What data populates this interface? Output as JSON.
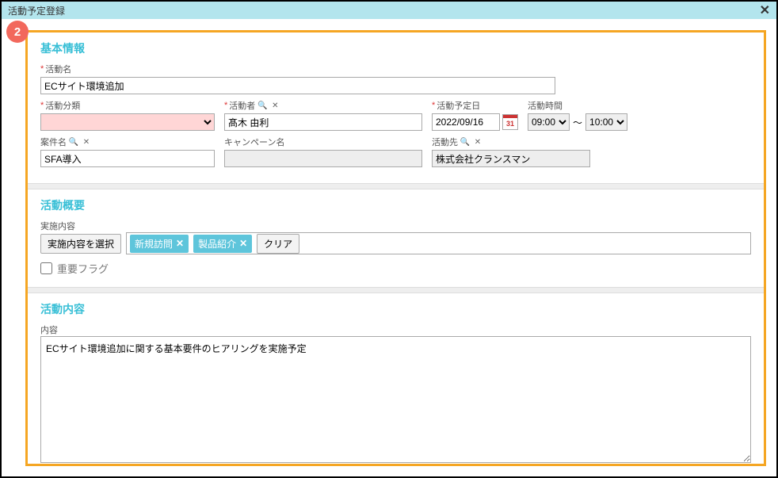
{
  "window": {
    "title": "活動予定登録"
  },
  "badge": "2",
  "section_basic": {
    "title": "基本情報",
    "activity_name": {
      "label": "活動名",
      "value": "ECサイト環境追加"
    },
    "activity_category": {
      "label": "活動分類"
    },
    "activity_person": {
      "label": "活動者",
      "value": "髙木 由利"
    },
    "scheduled_date": {
      "label": "活動予定日",
      "value": "2022/09/16",
      "cal_day": "31"
    },
    "activity_time": {
      "label": "活動時間",
      "from": "09:00",
      "to": "10:00"
    },
    "case_name": {
      "label": "案件名",
      "value": "SFA導入"
    },
    "campaign_name": {
      "label": "キャンペーン名",
      "value": ""
    },
    "activity_target": {
      "label": "活動先",
      "value": "株式会社クランスマン"
    }
  },
  "section_summary": {
    "title": "活動概要",
    "impl_label": "実施内容",
    "select_btn": "実施内容を選択",
    "tags": [
      "新規訪問",
      "製品紹介"
    ],
    "clear_btn": "クリア",
    "important_flag_label": "重要フラグ"
  },
  "section_detail": {
    "title": "活動内容",
    "content_label": "内容",
    "content_value": "ECサイト環境追加に関する基本要件のヒアリングを実施予定"
  }
}
